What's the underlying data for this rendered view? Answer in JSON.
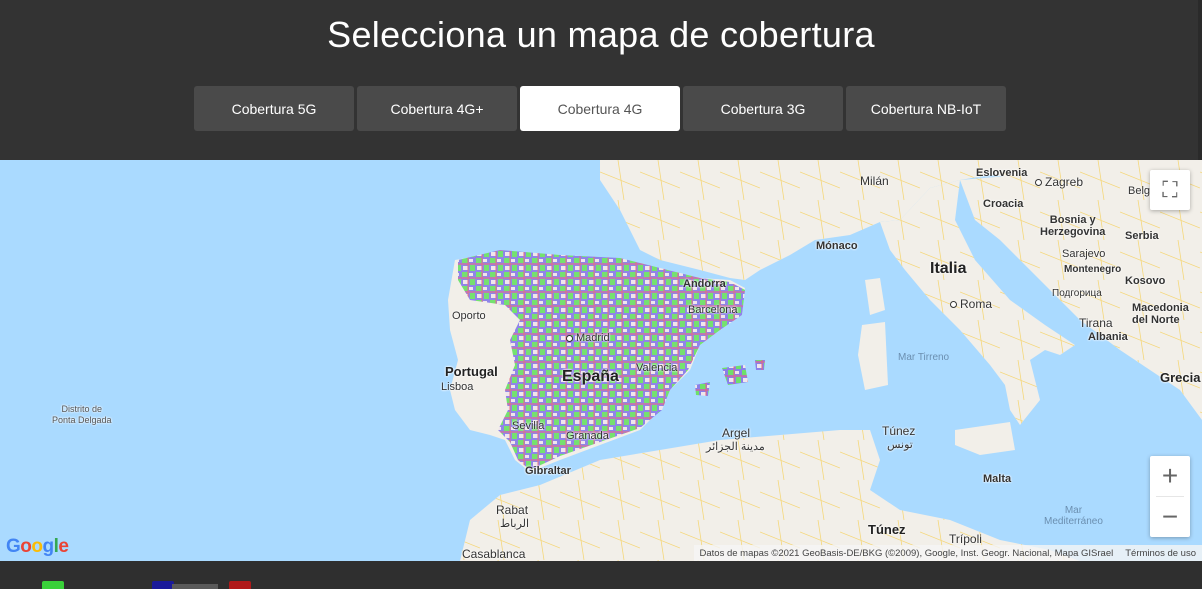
{
  "header": {
    "title": "Selecciona un mapa de cobertura",
    "tabs": [
      {
        "label": "Cobertura 5G",
        "active": false
      },
      {
        "label": "Cobertura 4G+",
        "active": false
      },
      {
        "label": "Cobertura 4G",
        "active": true
      },
      {
        "label": "Cobertura 3G",
        "active": false
      },
      {
        "label": "Cobertura NB-IoT",
        "active": false
      }
    ]
  },
  "map": {
    "labels": {
      "espana": "España",
      "portugal": "Portugal",
      "italia": "Italia",
      "madrid": "Madrid",
      "lisboa": "Lisboa",
      "oporto": "Oporto",
      "valencia": "Valencia",
      "barcelona": "Barcelona",
      "andorra": "Andorra",
      "sevilla": "Sevilla",
      "granada": "Granada",
      "gibraltar": "Gibraltar",
      "rabat": "Rabat",
      "rabat_ar": "الرباط",
      "casablanca": "Casablanca",
      "argel": "Argel",
      "argel_ar": "مدينة الجزائر",
      "tunez": "Túnez",
      "tunez_ar": "تونس",
      "tunez2": "Túnez",
      "tripoli": "Trípoli",
      "malta": "Malta",
      "roma": "Roma",
      "milan": "Milán",
      "monaco": "Mónaco",
      "eslovenia": "Eslovenia",
      "zagreb": "Zagreb",
      "croacia": "Croacia",
      "belgrado": "Belgrad",
      "bosnia": "Bosnia y\nHerzegovina",
      "sarajevo": "Sarajevo",
      "serbia": "Serbia",
      "montenegro": "Montenegro",
      "podgorica": "Подгорица",
      "kosovo": "Kosovo",
      "macedonia": "Macedonia\ndel Norte",
      "tirana": "Tirana",
      "albania": "Albania",
      "grecia": "Grecia",
      "mar_tirreno": "Mar Tirreno",
      "mar_mediterraneo": "Mar\nMediterráneo",
      "ponta_delgada": "Distrito de\nPonta Delgada"
    },
    "controls": {
      "fullscreen_icon": "fullscreen-icon",
      "zoom_in": "+",
      "zoom_out": "−"
    },
    "logo": "Google",
    "attribution": "Datos de mapas ©2021 GeoBasis-DE/BKG (©2009), Google, Inst. Geogr. Nacional, Mapa GISrael",
    "terms": "Términos de uso"
  },
  "colors": {
    "sea": "#aadaff",
    "land": "#f2efe9",
    "coverage_green": "#6ee06a",
    "coverage_purple": "#8a7fe8",
    "coverage_red": "#e8667a"
  }
}
